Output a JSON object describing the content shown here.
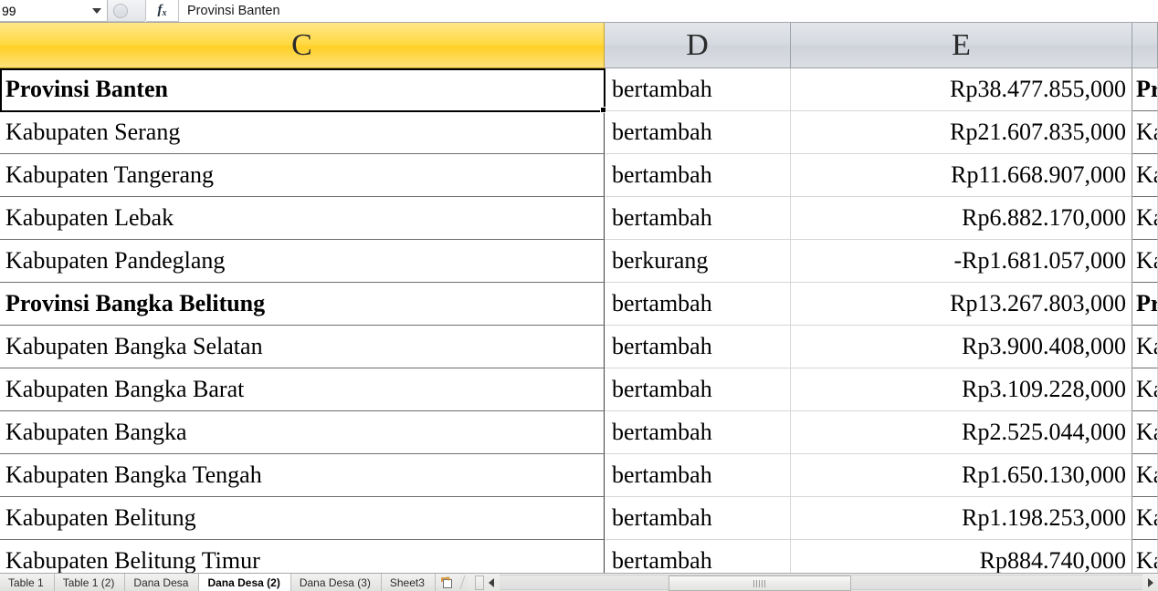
{
  "formula_bar": {
    "name_box_value": "99",
    "fx_label": "fx",
    "formula_value": "Provinsi Banten"
  },
  "grid": {
    "columns": [
      {
        "letter": "C",
        "selected": true
      },
      {
        "letter": "D",
        "selected": false
      },
      {
        "letter": "E",
        "selected": false
      }
    ],
    "rows": [
      {
        "c": "Provinsi Banten",
        "bold": true,
        "d": "bertambah",
        "e": "Rp38.477.855,000",
        "f": "Pr"
      },
      {
        "c": "Kabupaten Serang",
        "bold": false,
        "d": "bertambah",
        "e": "Rp21.607.835,000",
        "f": "Ka"
      },
      {
        "c": "Kabupaten Tangerang",
        "bold": false,
        "d": "bertambah",
        "e": "Rp11.668.907,000",
        "f": "Ka"
      },
      {
        "c": "Kabupaten Lebak",
        "bold": false,
        "d": "bertambah",
        "e": "Rp6.882.170,000",
        "f": "Ka"
      },
      {
        "c": "Kabupaten Pandeglang",
        "bold": false,
        "d": "berkurang",
        "e": "-Rp1.681.057,000",
        "f": "Ka"
      },
      {
        "c": "Provinsi Bangka Belitung",
        "bold": true,
        "d": "bertambah",
        "e": "Rp13.267.803,000",
        "f": "Pr"
      },
      {
        "c": "Kabupaten Bangka Selatan",
        "bold": false,
        "d": "bertambah",
        "e": "Rp3.900.408,000",
        "f": "Ka"
      },
      {
        "c": "Kabupaten Bangka Barat",
        "bold": false,
        "d": "bertambah",
        "e": "Rp3.109.228,000",
        "f": "Ka"
      },
      {
        "c": "Kabupaten Bangka",
        "bold": false,
        "d": "bertambah",
        "e": "Rp2.525.044,000",
        "f": "Ka"
      },
      {
        "c": "Kabupaten Bangka Tengah",
        "bold": false,
        "d": "bertambah",
        "e": "Rp1.650.130,000",
        "f": "Ka"
      },
      {
        "c": "Kabupaten Belitung",
        "bold": false,
        "d": "bertambah",
        "e": "Rp1.198.253,000",
        "f": "Ka"
      },
      {
        "c": "Kabupaten Belitung Timur",
        "bold": false,
        "d": "bertambah",
        "e": "Rp884.740,000",
        "f": "Ka"
      }
    ]
  },
  "sheet_tabs": {
    "items": [
      {
        "label": "Table 1",
        "active": false
      },
      {
        "label": "Table 1 (2)",
        "active": false
      },
      {
        "label": "Dana Desa",
        "active": false
      },
      {
        "label": "Dana Desa (2)",
        "active": true
      },
      {
        "label": "Dana Desa (3)",
        "active": false
      },
      {
        "label": "Sheet3",
        "active": false
      }
    ],
    "new_sheet_icon": "new-sheet-icon"
  },
  "colors": {
    "selected_header": "#ffd83e",
    "header_gray": "#d6dae0",
    "active_cell_border": "#000000"
  }
}
